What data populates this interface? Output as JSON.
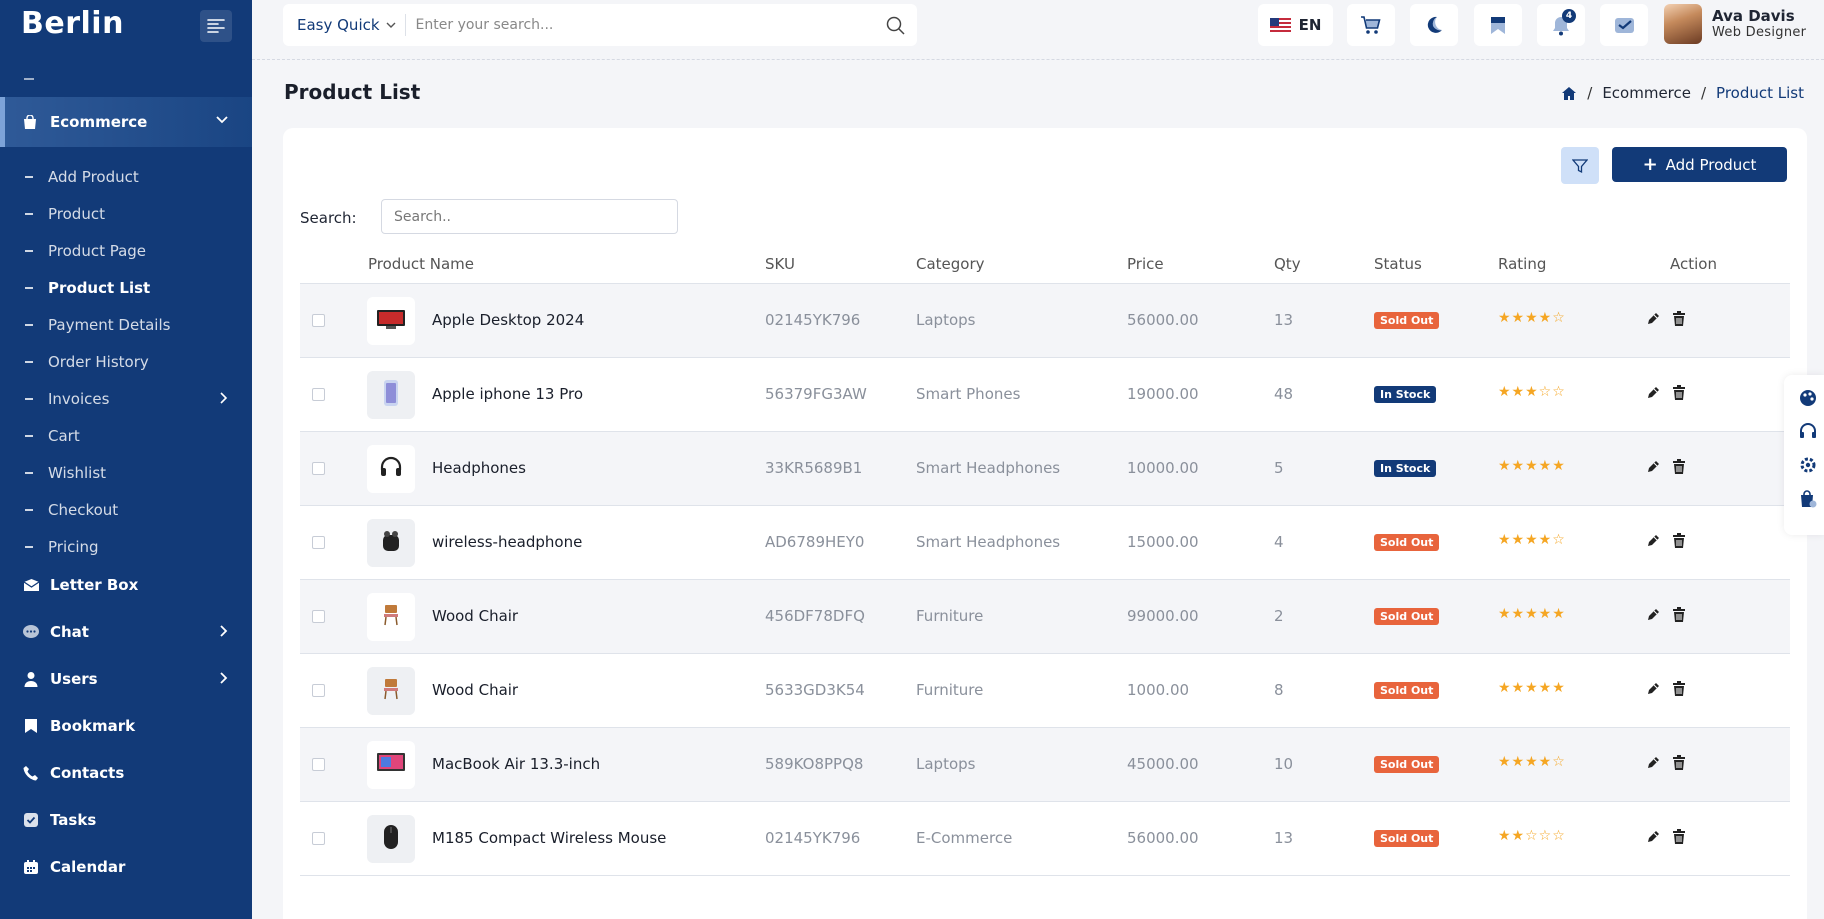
{
  "brand": "Berlin",
  "sidebar": {
    "active_group": "Ecommerce",
    "submenu": [
      {
        "label": "Add Product"
      },
      {
        "label": "Product"
      },
      {
        "label": "Product Page"
      },
      {
        "label": "Product List",
        "active": true
      },
      {
        "label": "Payment Details"
      },
      {
        "label": "Order History"
      },
      {
        "label": "Invoices",
        "has_children": true
      },
      {
        "label": "Cart"
      },
      {
        "label": "Wishlist"
      },
      {
        "label": "Checkout"
      },
      {
        "label": "Pricing"
      }
    ],
    "items": [
      {
        "label": "Letter Box",
        "icon": "envelope-icon"
      },
      {
        "label": "Chat",
        "icon": "chat-bubble-icon",
        "has_children": true
      },
      {
        "label": "Users",
        "icon": "user-icon",
        "has_children": true
      },
      {
        "label": "Bookmark",
        "icon": "bookmark-icon"
      },
      {
        "label": "Contacts",
        "icon": "phone-icon"
      },
      {
        "label": "Tasks",
        "icon": "checkbox-icon"
      },
      {
        "label": "Calendar",
        "icon": "calendar-icon"
      }
    ]
  },
  "header": {
    "quick_label": "Easy Quick",
    "search_placeholder": "Enter your search...",
    "language": "EN",
    "notifications_count": "4",
    "user_name": "Ava Davis",
    "user_role": "Web Designer"
  },
  "page": {
    "title": "Product List",
    "breadcrumb": [
      "Ecommerce",
      "Product List"
    ]
  },
  "toolbar": {
    "add_label": "Add Product",
    "search_label": "Search:",
    "search_placeholder": "Search.."
  },
  "table": {
    "columns": [
      "Product Name",
      "SKU",
      "Category",
      "Price",
      "Qty",
      "Status",
      "Rating",
      "Action"
    ],
    "rows": [
      {
        "name": "Apple Desktop 2024",
        "sku": "02145YK796",
        "category": "Laptops",
        "price": "56000.00",
        "qty": "13",
        "status": "Sold Out",
        "rating": 4,
        "thumb": "desktop-icon"
      },
      {
        "name": "Apple iphone 13 Pro",
        "sku": "56379FG3AW",
        "category": "Smart Phones",
        "price": "19000.00",
        "qty": "48",
        "status": "In Stock",
        "rating": 3,
        "thumb": "phone-icon"
      },
      {
        "name": "Headphones",
        "sku": "33KR5689B1",
        "category": "Smart Headphones",
        "price": "10000.00",
        "qty": "5",
        "status": "In Stock",
        "rating": 5,
        "thumb": "headphones-icon"
      },
      {
        "name": "wireless-headphone",
        "sku": "AD6789HEY0",
        "category": "Smart Headphones",
        "price": "15000.00",
        "qty": "4",
        "status": "Sold Out",
        "rating": 4,
        "thumb": "earbuds-icon"
      },
      {
        "name": "Wood Chair",
        "sku": "456DF78DFQ",
        "category": "Furniture",
        "price": "99000.00",
        "qty": "2",
        "status": "Sold Out",
        "rating": 5,
        "thumb": "chair-icon"
      },
      {
        "name": "Wood Chair",
        "sku": "5633GD3K54",
        "category": "Furniture",
        "price": "1000.00",
        "qty": "8",
        "status": "Sold Out",
        "rating": 5,
        "thumb": "chair-icon"
      },
      {
        "name": "MacBook Air 13.3-inch",
        "sku": "589KO8PPQ8",
        "category": "Laptops",
        "price": "45000.00",
        "qty": "10",
        "status": "Sold Out",
        "rating": 4,
        "thumb": "laptop-icon"
      },
      {
        "name": "M185 Compact Wireless Mouse",
        "sku": "02145YK796",
        "category": "E-Commerce",
        "price": "56000.00",
        "qty": "13",
        "status": "Sold Out",
        "rating": 2,
        "thumb": "mouse-icon"
      }
    ]
  },
  "colors": {
    "sidebar": "#123a78",
    "accent": "#123a78",
    "sold_out": "#e8643c",
    "in_stock": "#123a78",
    "star": "#f5a623"
  }
}
